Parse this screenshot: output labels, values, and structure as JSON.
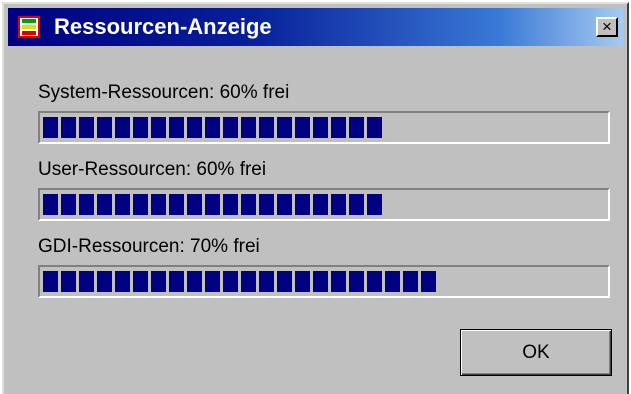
{
  "window": {
    "title": "Ressourcen-Anzeige",
    "close_label": "×",
    "icon": "resource-meter-icon"
  },
  "resources": [
    {
      "label": "System-Ressourcen: 60% frei",
      "free_percent": 60
    },
    {
      "label": "User-Ressourcen: 60% frei",
      "free_percent": 60
    },
    {
      "label": "GDI-Ressourcen: 70% frei",
      "free_percent": 70
    }
  ],
  "buttons": {
    "ok_label": "OK"
  },
  "colors": {
    "bar_fill": "#000080",
    "dialog_bg": "#c0c0c0",
    "title_gradient_start": "#000080",
    "title_gradient_end": "#a6caf0"
  }
}
